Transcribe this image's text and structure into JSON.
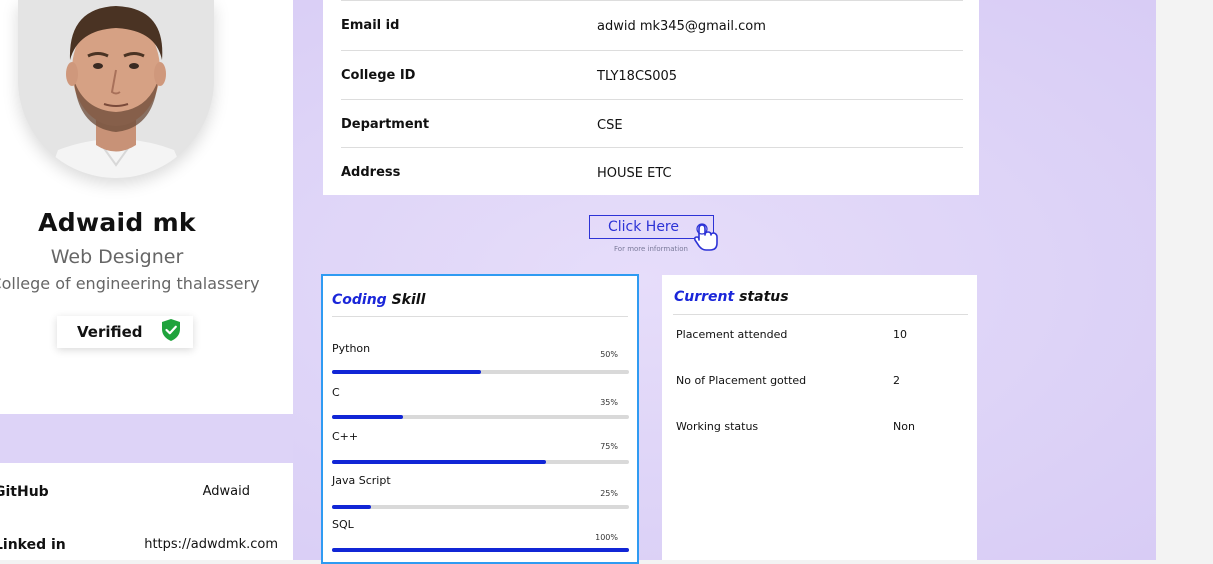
{
  "profile": {
    "name": "Adwaid mk",
    "role": "Web Designer",
    "college": "College of engineering thalassery",
    "verified_label": "Verified"
  },
  "socials": [
    {
      "label": "GitHub",
      "value": "Adwaid"
    },
    {
      "label": "Linked in",
      "value": "https://adwdmk.com"
    }
  ],
  "details": [
    {
      "label": "Email id",
      "value": "adwid mk345@gmail.com"
    },
    {
      "label": "College ID",
      "value": "TLY18CS005"
    },
    {
      "label": "Department",
      "value": "CSE"
    },
    {
      "label": "Address",
      "value": "HOUSE ETC"
    }
  ],
  "click": {
    "label": "Click Here",
    "hint": "For more information"
  },
  "coding_skill": {
    "title_accent": "Coding",
    "title_rest": "Skill",
    "skills": [
      {
        "name": "Python",
        "percent_label": "50%",
        "percent": 50
      },
      {
        "name": "C",
        "percent_label": "35%",
        "percent": 24
      },
      {
        "name": "C++",
        "percent_label": "75%",
        "percent": 72
      },
      {
        "name": "Java Script",
        "percent_label": "25%",
        "percent": 13
      },
      {
        "name": "SQL",
        "percent_label": "100%",
        "percent": 100
      }
    ]
  },
  "current_status": {
    "title_accent": "Current",
    "title_rest": "status",
    "rows": [
      {
        "label": "Placement attended",
        "value": "10"
      },
      {
        "label": "No of Placement gotted",
        "value": "2"
      },
      {
        "label": "Working status",
        "value": "Non"
      }
    ]
  },
  "colors": {
    "background": "#ddd3f7",
    "accent": "#1a26d9",
    "verified_icon": "#1fa33c",
    "skill_card_border": "#2f9bf2"
  },
  "icons": {
    "verified": "shield-check-icon",
    "click": "pointer-hand-icon"
  }
}
